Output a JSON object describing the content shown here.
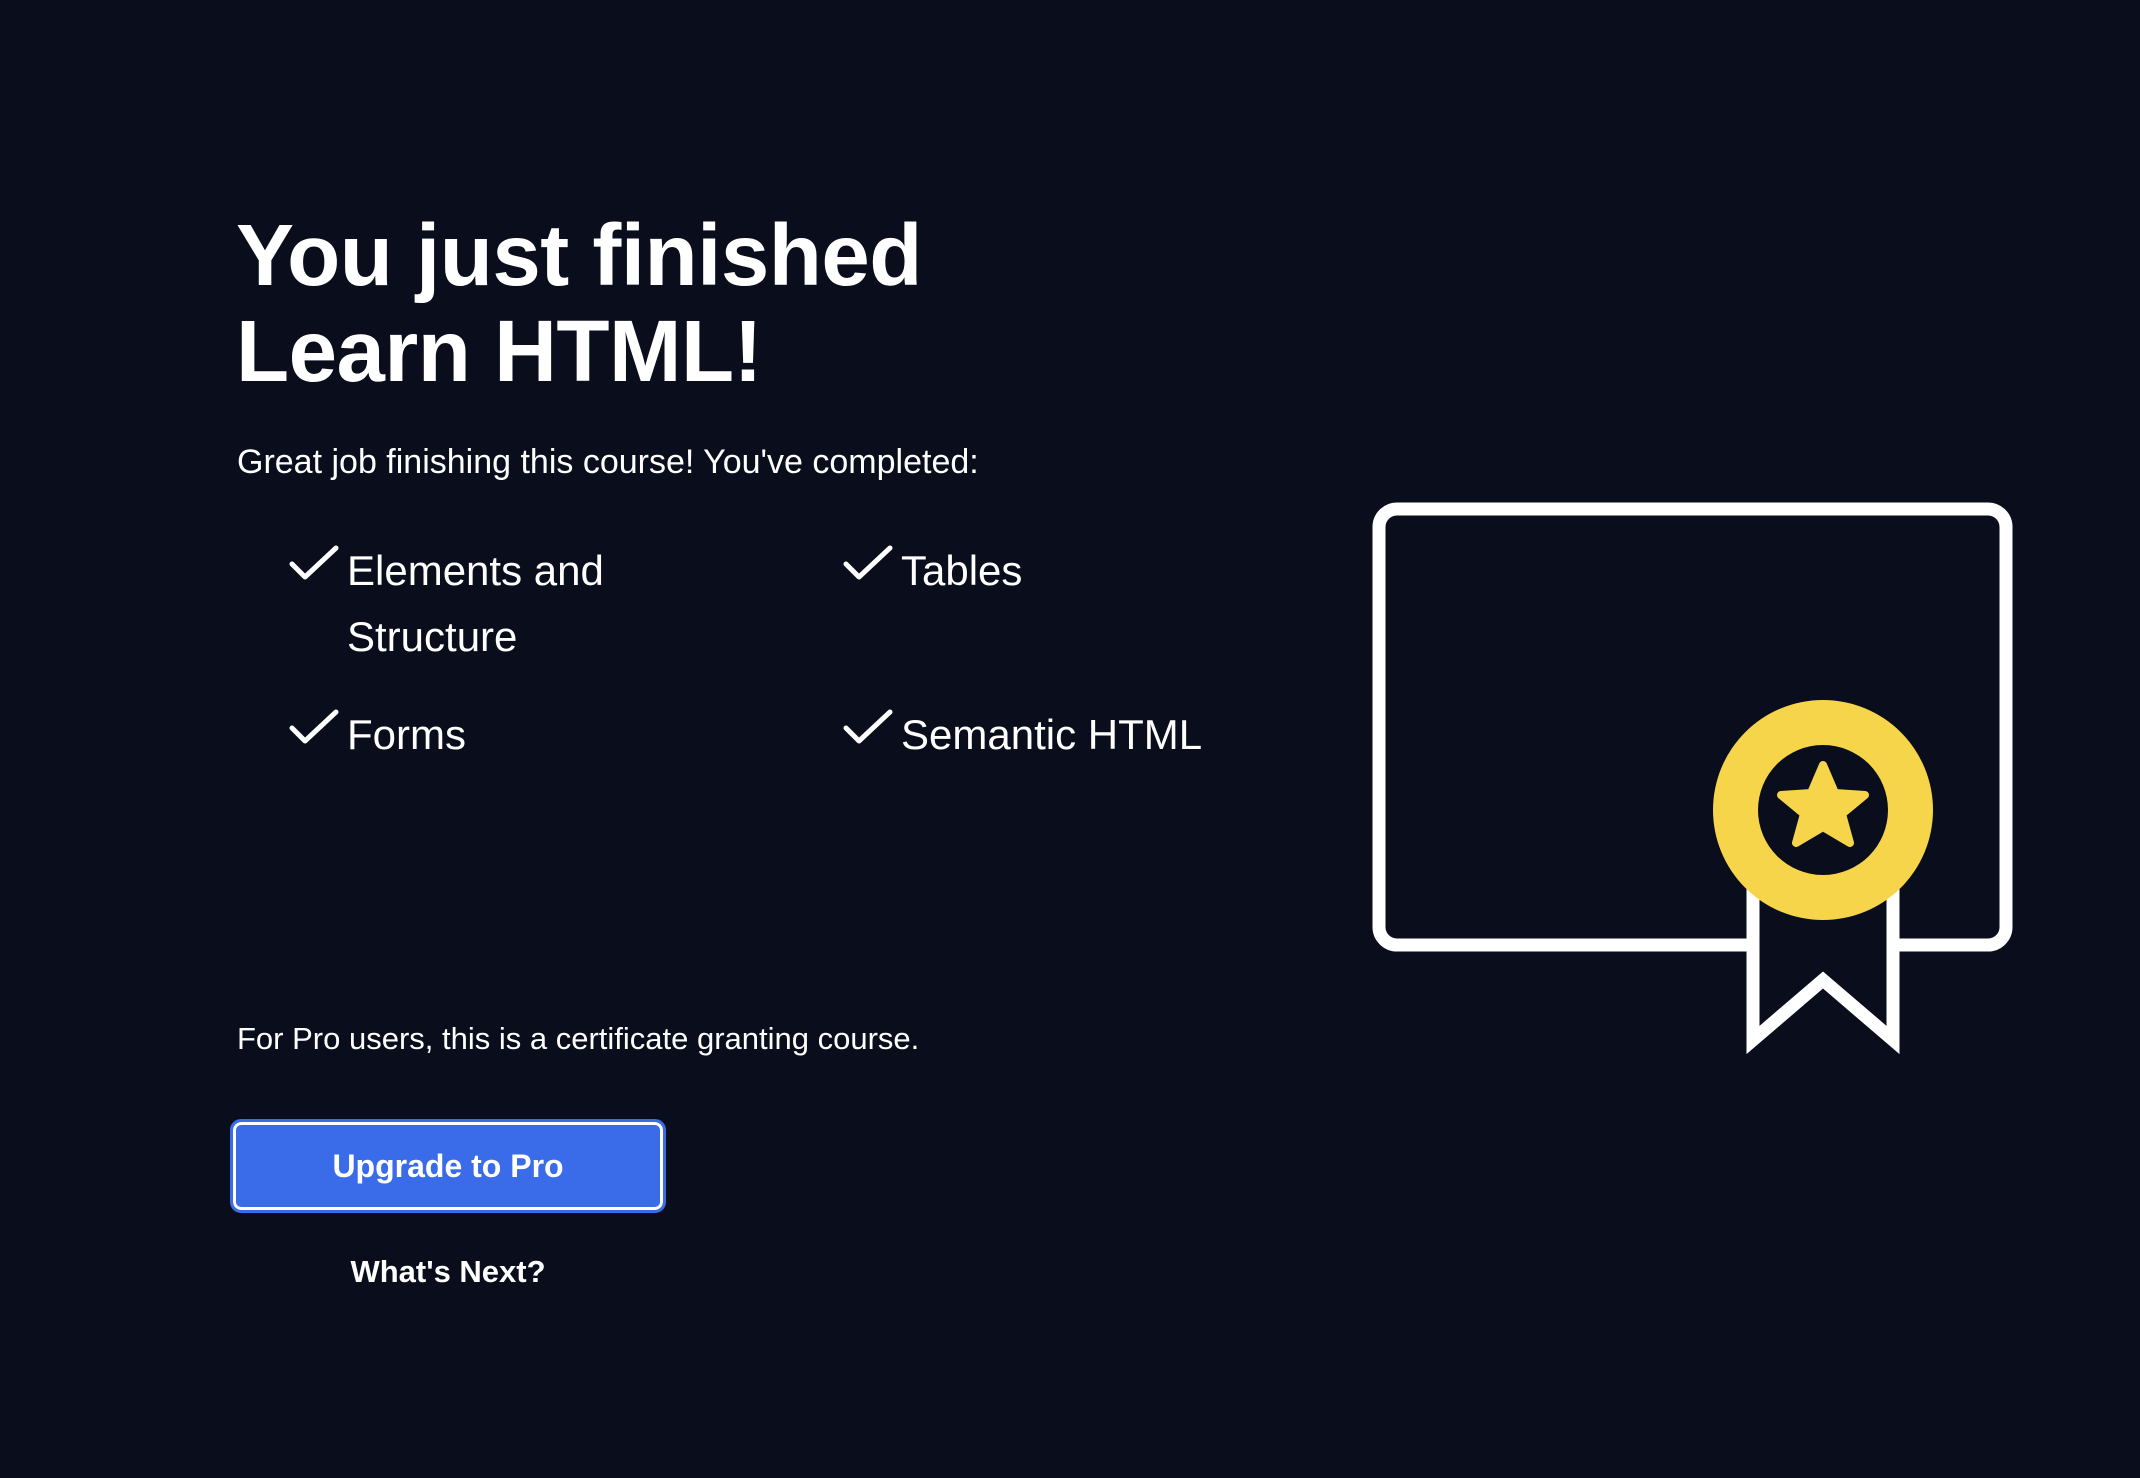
{
  "headline": {
    "line1": "You just finished",
    "line2": "Learn HTML!"
  },
  "intro": "Great job finishing this course! You've completed:",
  "completed_items": [
    {
      "label": "Elements and Structure",
      "icon": "check-icon"
    },
    {
      "label": "Tables",
      "icon": "check-icon"
    },
    {
      "label": "Forms",
      "icon": "check-icon"
    },
    {
      "label": "Semantic HTML",
      "icon": "check-icon"
    }
  ],
  "pro_note": "For Pro users, this is a certificate granting course.",
  "actions": {
    "upgrade_label": "Upgrade to Pro",
    "whats_next_label": "What's Next?"
  },
  "illustration": {
    "icon": "certificate-icon",
    "badge_icon": "star-badge-icon"
  },
  "colors": {
    "background": "#0a0d1c",
    "text": "#ffffff",
    "accent_blue": "#3a6be8",
    "badge_yellow": "#f7d54a"
  }
}
